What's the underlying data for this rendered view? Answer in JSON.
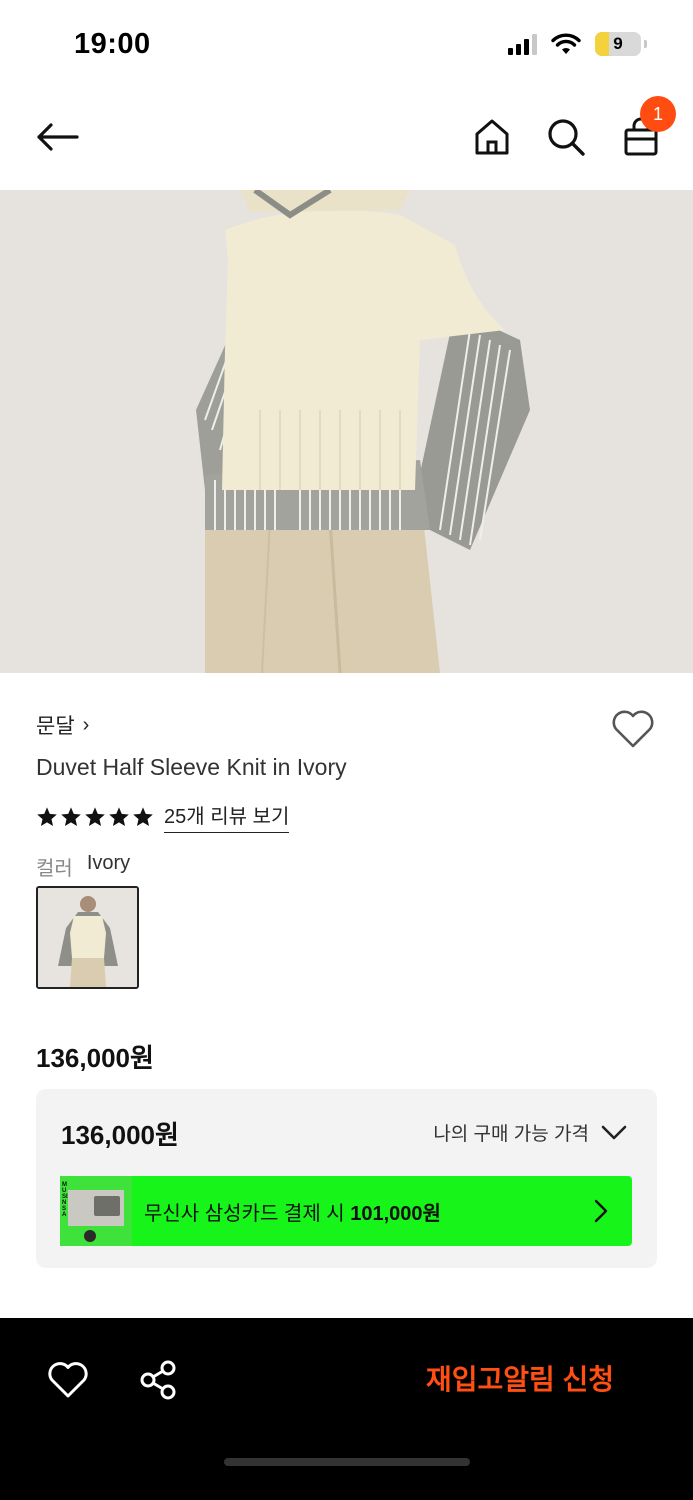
{
  "status_bar": {
    "time": "19:00",
    "battery": "9"
  },
  "header": {
    "cart_count": "1"
  },
  "product": {
    "brand": "문달",
    "brand_chevron": "›",
    "title": "Duvet Half Sleeve Knit in Ivory",
    "rating_stars": 5,
    "review_link": "25개 리뷰 보기",
    "color_label": "컬러",
    "color_value": "Ivory",
    "price": "136,000원"
  },
  "price_box": {
    "price": "136,000원",
    "dropdown_label": "나의 구매 가능 가격",
    "card_offer_prefix": "무신사 삼성카드 결제 시 ",
    "card_offer_price": "101,000원",
    "card_thumb_text": "MUSINSA"
  },
  "bottom_bar": {
    "restock_label": "재입고알림 신청"
  },
  "colors": {
    "accent": "#ff4d12",
    "card_banner": "#17f41a",
    "bottom_bar": "#000000"
  },
  "icons": [
    "back-arrow-icon",
    "home-icon",
    "search-icon",
    "shopping-bag-icon",
    "heart-icon",
    "share-icon",
    "star-icon",
    "chevron-down-icon",
    "chevron-right-icon"
  ]
}
